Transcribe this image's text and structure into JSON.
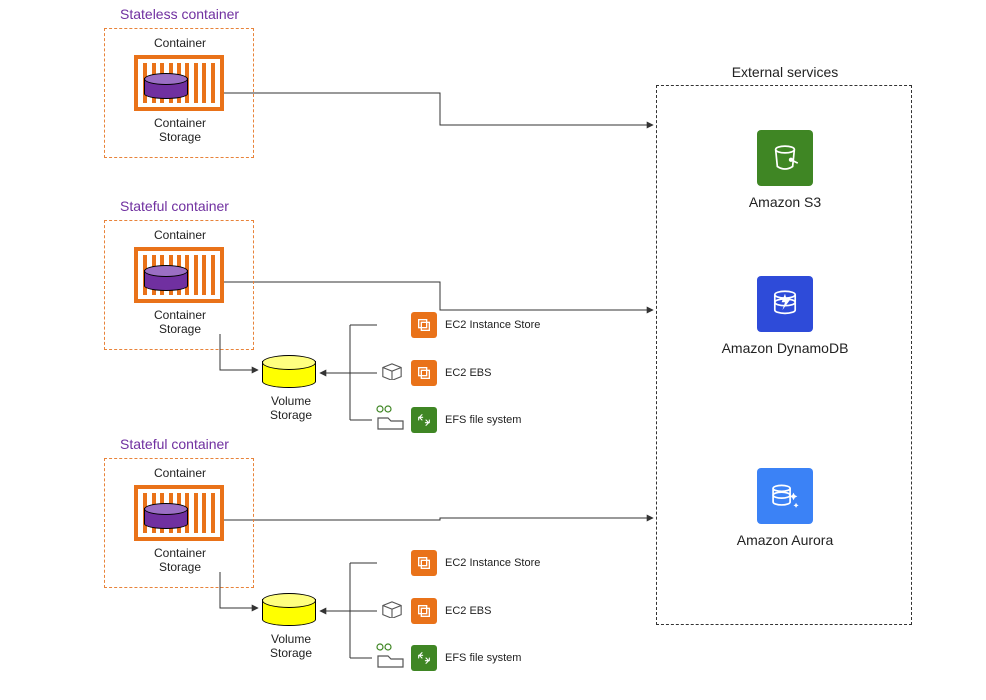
{
  "diagram": {
    "stateless": {
      "title": "Stateless container",
      "container_label": "Container",
      "storage_label": "Container Storage"
    },
    "stateful1": {
      "title": "Stateful container",
      "container_label": "Container",
      "storage_label": "Container Storage",
      "volume_label": "Volume Storage",
      "backend1": "EC2 Instance Store",
      "backend2": "EC2 EBS",
      "backend3": "EFS file system"
    },
    "stateful2": {
      "title": "Stateful container",
      "container_label": "Container",
      "storage_label": "Container Storage",
      "volume_label": "Volume Storage",
      "backend1": "EC2 Instance Store",
      "backend2": "EC2 EBS",
      "backend3": "EFS file system"
    },
    "external": {
      "title": "External services",
      "s3": "Amazon S3",
      "dynamodb": "Amazon DynamoDB",
      "aurora": "Amazon Aurora"
    }
  },
  "colors": {
    "orange": "#e97219",
    "purple": "#7030a0",
    "yellow": "#ffff00",
    "s3_green": "#3f8624",
    "ddb_blue": "#2e4bd9",
    "aurora_blue": "#3b82f6"
  }
}
